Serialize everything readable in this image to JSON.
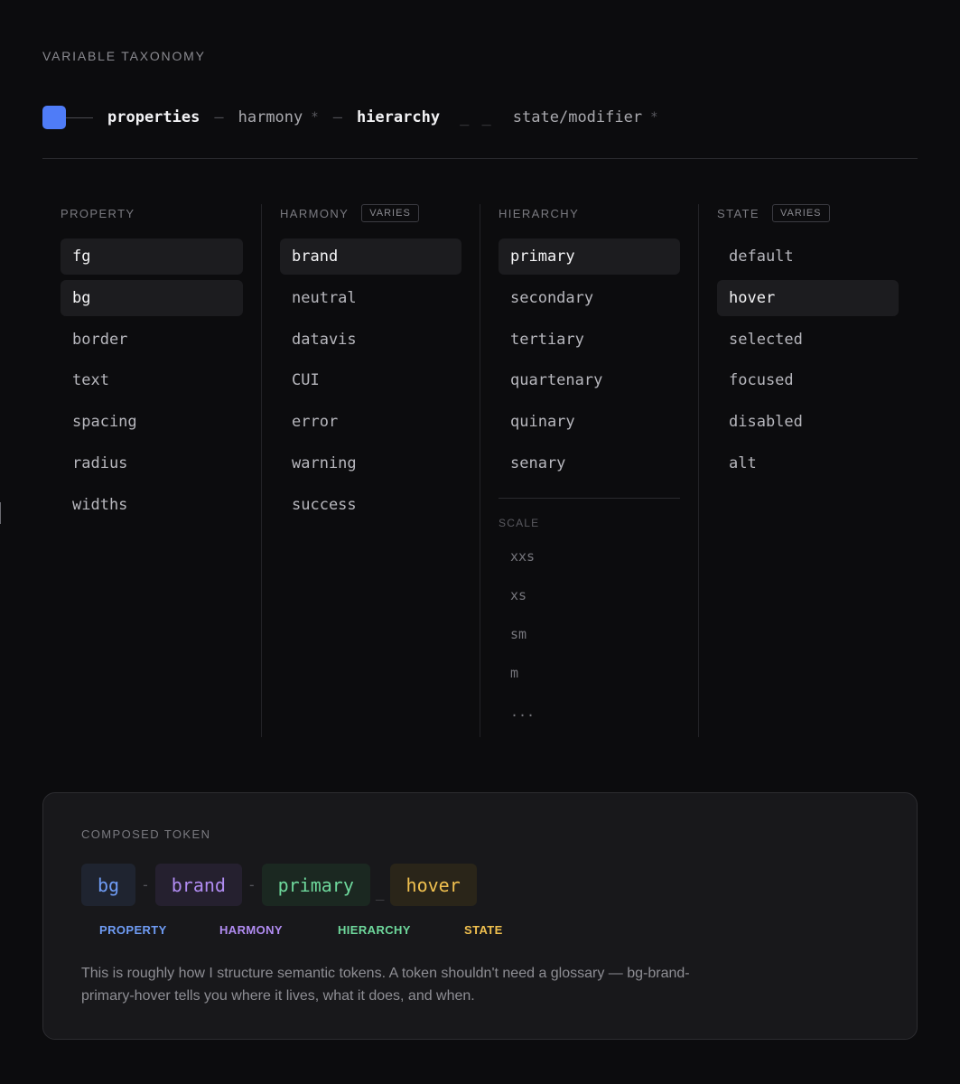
{
  "header": {
    "title": "VARIABLE TAXONOMY"
  },
  "formula": {
    "properties": "properties",
    "harmony": "harmony",
    "hierarchy": "hierarchy",
    "state": "state/modifier",
    "sep_dash": "–",
    "sep_underscore": "_ _",
    "optional_mark": "*",
    "accent_color": "#4f7cf7"
  },
  "columns": {
    "property": {
      "title": "PROPERTY",
      "items": [
        "fg",
        "bg",
        "border",
        "text",
        "spacing",
        "radius",
        "widths"
      ]
    },
    "harmony": {
      "title": "HARMONY",
      "badge": "VARIES",
      "items": [
        "brand",
        "neutral",
        "datavis",
        "CUI",
        "error",
        "warning",
        "success"
      ]
    },
    "hierarchy": {
      "title": "HIERARCHY",
      "items": [
        "primary",
        "secondary",
        "tertiary",
        "quartenary",
        "quinary",
        "senary"
      ],
      "scale_title": "SCALE",
      "scale_items": [
        "xxs",
        "xs",
        "sm",
        "m",
        "..."
      ]
    },
    "state": {
      "title": "STATE",
      "badge": "VARIES",
      "items": [
        "default",
        "hover",
        "selected",
        "focused",
        "disabled",
        "alt"
      ]
    }
  },
  "composed": {
    "title": "COMPOSED TOKEN",
    "tokens": {
      "property": "bg",
      "harmony": "brand",
      "hierarchy": "primary",
      "state": "hover"
    },
    "separators": {
      "dash": "-",
      "underscore": "_"
    },
    "legend": {
      "property": "PROPERTY",
      "harmony": "HARMONY",
      "hierarchy": "HIERARCHY",
      "state": "STATE"
    },
    "colors": {
      "property": "#6f9cf5",
      "harmony": "#b18cf2",
      "hierarchy": "#6ed89c",
      "state": "#f0c04f"
    },
    "description": "This is roughly how I structure semantic tokens. A token shouldn't need a glossary — bg-brand-primary-hover tells you where it lives, what it does, and when."
  }
}
